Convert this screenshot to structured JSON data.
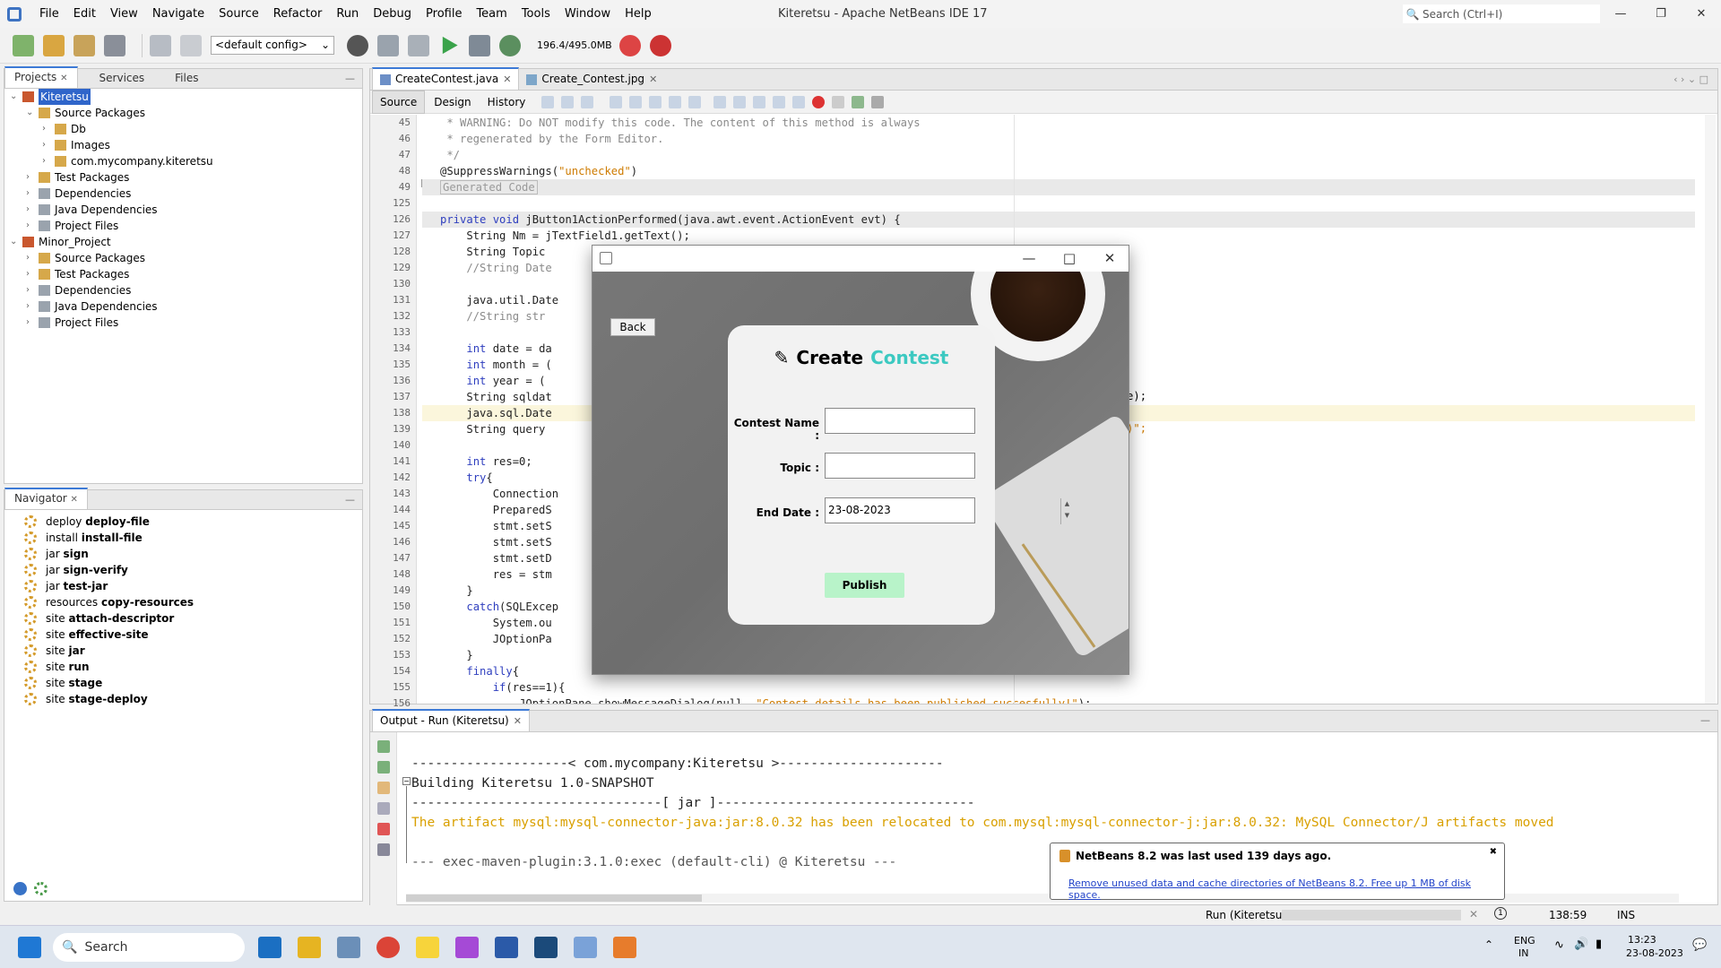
{
  "window": {
    "title": "Kiteretsu - Apache NetBeans IDE 17",
    "search_placeholder": "Search (Ctrl+I)"
  },
  "menu": [
    "File",
    "Edit",
    "View",
    "Navigate",
    "Source",
    "Refactor",
    "Run",
    "Debug",
    "Profile",
    "Team",
    "Tools",
    "Window",
    "Help"
  ],
  "toolbar": {
    "config": "<default config>",
    "memory": "196.4/495.0MB"
  },
  "projects": {
    "tabs": [
      "Projects",
      "Services",
      "Files"
    ],
    "tree": [
      {
        "label": "Kiteretsu",
        "selected": true
      },
      {
        "label": "Source Packages"
      },
      {
        "label": "Db"
      },
      {
        "label": "Images"
      },
      {
        "label": "com.mycompany.kiteretsu"
      },
      {
        "label": "Test Packages"
      },
      {
        "label": "Dependencies"
      },
      {
        "label": "Java Dependencies"
      },
      {
        "label": "Project Files"
      },
      {
        "label": "Minor_Project"
      },
      {
        "label": "Source Packages"
      },
      {
        "label": "Test Packages"
      },
      {
        "label": "Dependencies"
      },
      {
        "label": "Java Dependencies"
      },
      {
        "label": "Project Files"
      }
    ]
  },
  "navigator": {
    "title": "Navigator",
    "items": [
      {
        "prefix": "deploy",
        "goal": "deploy-file"
      },
      {
        "prefix": "install",
        "goal": "install-file"
      },
      {
        "prefix": "jar",
        "goal": "sign"
      },
      {
        "prefix": "jar",
        "goal": "sign-verify"
      },
      {
        "prefix": "jar",
        "goal": "test-jar"
      },
      {
        "prefix": "resources",
        "goal": "copy-resources"
      },
      {
        "prefix": "site",
        "goal": "attach-descriptor"
      },
      {
        "prefix": "site",
        "goal": "effective-site"
      },
      {
        "prefix": "site",
        "goal": "jar"
      },
      {
        "prefix": "site",
        "goal": "run"
      },
      {
        "prefix": "site",
        "goal": "stage"
      },
      {
        "prefix": "site",
        "goal": "stage-deploy"
      }
    ]
  },
  "editor": {
    "tabs": [
      "CreateContest.java",
      "Create_Contest.jpg"
    ],
    "subtabs": [
      "Source",
      "Design",
      "History"
    ],
    "line_numbers": [
      "45",
      "46",
      "47",
      "48",
      "49",
      "125",
      "126",
      "127",
      "128",
      "129",
      "130",
      "131",
      "132",
      "133",
      "134",
      "135",
      "136",
      "137",
      "138",
      "139",
      "140",
      "141",
      "142",
      "143",
      "144",
      "145",
      "146",
      "147",
      "148",
      "149",
      "150",
      "151",
      "152",
      "153",
      "154",
      "155",
      "156"
    ],
    "code": [
      " * WARNING: Do NOT modify this code. The content of this method is always",
      " * regenerated by the Form Editor.",
      " */",
      "@SuppressWarnings(\"unchecked\")",
      "Generated Code",
      "",
      "private void jButton1ActionPerformed(java.awt.event.ActionEvent evt) {",
      "    String Nm = jTextField1.getText();",
      "    String Topic",
      "    //String Date",
      "",
      "    java.util.Date",
      "    //String str",
      "",
      "    int date = da",
      "    int month = (",
      "    int year = (",
      "    String sqldat",
      "    java.sql.Date",
      "    String query",
      "",
      "    int res=0;",
      "    try{",
      "        Connection",
      "        PreparedS",
      "        stmt.setS",
      "        stmt.setS",
      "        stmt.setD",
      "        res = stm",
      "    }",
      "    catch(SQLExcep",
      "        System.ou",
      "        JOptionPa",
      "    }",
      "    finally{",
      "        if(res==1){",
      "            JOptionPane.showMessageDialog(null, \"Contest details has been published succesfully!\");"
    ],
    "right_fragments": {
      "line137": "Of(date);",
      "line139": "(?,?,?)\";"
    }
  },
  "output": {
    "title": "Output - Run (Kiteretsu)",
    "lines": [
      "--------------------< com.mycompany:Kiteretsu >---------------------",
      "Building Kiteretsu 1.0-SNAPSHOT",
      "--------------------------------[ jar ]---------------------------------",
      "The artifact mysql:mysql-connector-java:jar:8.0.32 has been relocated to com.mysql:mysql-connector-j:jar:8.0.32: MySQL Connector/J artifacts moved",
      "",
      "--- exec-maven-plugin:3.1.0:exec (default-cli) @ Kiteretsu ---"
    ]
  },
  "status": {
    "task": "Run (Kiteretsu)",
    "position": "138:59",
    "mode": "INS"
  },
  "notification": {
    "title": "NetBeans 8.2 was last used 139 days ago.",
    "link": "Remove unused data and cache directories of NetBeans 8.2. Free up 1 MB of disk space."
  },
  "dialog": {
    "back": "Back",
    "title_word1": "Create",
    "title_word2": "Contest",
    "contest_name_label": "Contest Name :",
    "topic_label": "Topic :",
    "end_date_label": "End Date :",
    "end_date_value": "23-08-2023",
    "publish": "Publish",
    "accent": "#3cc9c1"
  },
  "taskbar": {
    "search": "Search",
    "lang1": "ENG",
    "lang2": "IN",
    "time": "13:23",
    "date": "23-08-2023"
  }
}
